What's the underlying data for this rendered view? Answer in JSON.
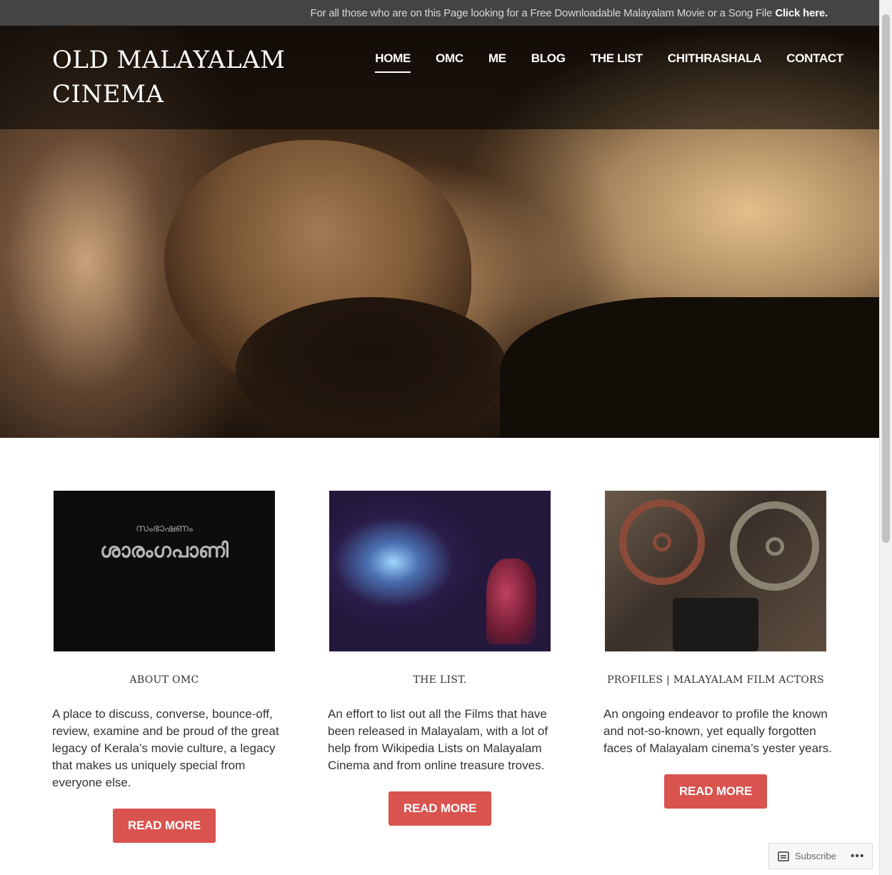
{
  "topbar": {
    "message": "For all those who are on this Page looking for a Free Downloadable Malayalam Movie or a Song File",
    "link": "Click here."
  },
  "site": {
    "title": "OLD MALAYALAM CINEMA"
  },
  "nav": {
    "items": [
      {
        "label": "HOME",
        "active": true
      },
      {
        "label": "OMC"
      },
      {
        "label": "ME"
      },
      {
        "label": "BLOG"
      },
      {
        "label": "THE LIST"
      },
      {
        "label": "CHITHRASHALA"
      },
      {
        "label": "CONTACT"
      }
    ]
  },
  "cards": [
    {
      "thumb_text_top": "സംഭാഷണം",
      "thumb_text_main": "ശാരംഗപാണി",
      "label": "ABOUT OMC",
      "desc": "A place to discuss, converse, bounce-off, review, examine and be proud of the great legacy of Kerala’s movie culture, a legacy that makes us uniquely special from everyone else.",
      "button": "READ MORE"
    },
    {
      "label": "THE LIST.",
      "desc": "An effort to list out all the Films that have been released in Malayalam, with a lot of help from Wikipedia Lists on Malayalam Cinema and from online treasure troves.",
      "button": "READ MORE"
    },
    {
      "label": "PROFILES | MALAYALAM FILM ACTORS",
      "desc": "An ongoing endeavor to profile the known and not-so-known, yet equally forgotten faces of Malayalam cinema’s yester years.",
      "button": "READ MORE"
    }
  ],
  "subscribe": {
    "label": "Subscribe",
    "more": "•••"
  },
  "colors": {
    "accent": "#d9534f",
    "topbar": "#444444"
  }
}
